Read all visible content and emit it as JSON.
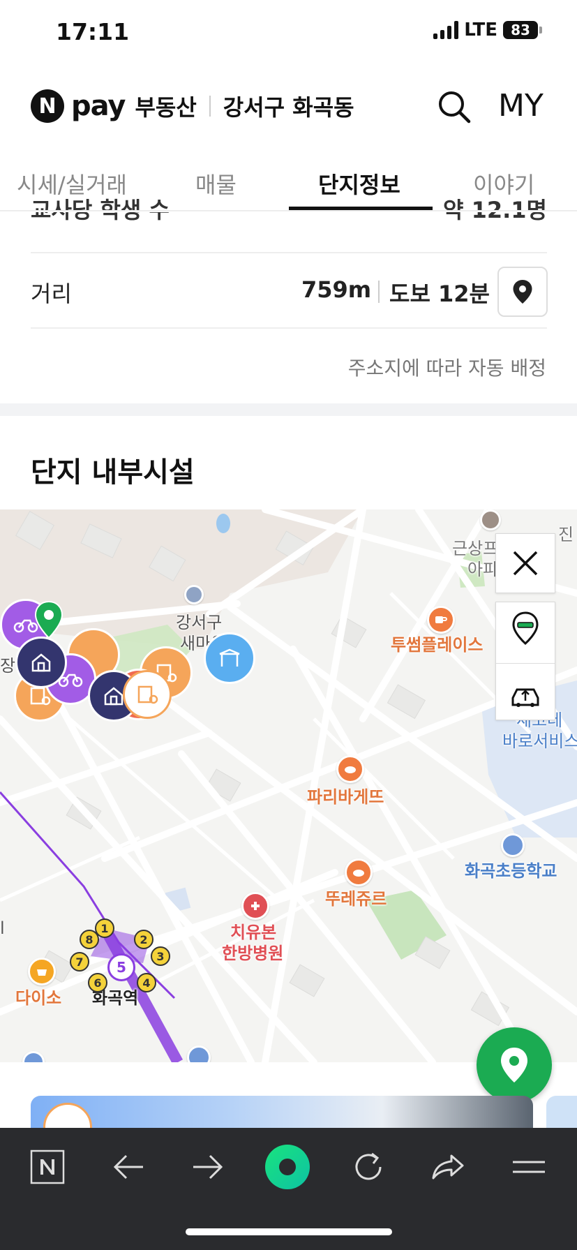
{
  "status_bar": {
    "time": "17:11",
    "network": "LTE",
    "battery": "83"
  },
  "header": {
    "logo_n": "N",
    "logo_pay": "pay",
    "brand": "부동산",
    "region": "강서구 화곡동",
    "my_label": "MY"
  },
  "tabs": [
    {
      "label": "시세/실거래",
      "active": false
    },
    {
      "label": "매물",
      "active": false
    },
    {
      "label": "단지정보",
      "active": true
    },
    {
      "label": "이야기",
      "active": false
    }
  ],
  "info": {
    "cut_row_label": "교사당 학생 수",
    "cut_row_value": "약 12.1명",
    "distance_label": "거리",
    "distance_meters": "759m",
    "distance_walk": "도보 12분",
    "auto_assign_note": "주소지에 따라 자동 배정"
  },
  "facilities": {
    "title": "단지 내부시설"
  },
  "map": {
    "labels": {
      "gangseo_1": "강서구",
      "gangseo_2": "새마을",
      "geunsang_1": "근상프",
      "geunsang_2": "아파",
      "jin": "진",
      "twosome": "투썸플레이스",
      "paris": "파리바게뜨",
      "touslesjours": "뚜레쥬르",
      "hospital_1": "치유본",
      "hospital_2": "한방병원",
      "school": "화곡초등학교",
      "baro_1": "세코레",
      "baro_2": "바로서비스",
      "daiso": "다이소",
      "station": "화곡역",
      "line_num": "5",
      "jang": "장",
      "edge_left": "l"
    },
    "exits": [
      "1",
      "2",
      "3",
      "4",
      "6",
      "7",
      "8"
    ]
  },
  "colors": {
    "accent_green": "#1bab52",
    "subway_purple": "#8a3ee0",
    "poi_orange": "#f07b3f",
    "poi_purple": "#a25ce6",
    "poi_navy": "#33356e"
  }
}
